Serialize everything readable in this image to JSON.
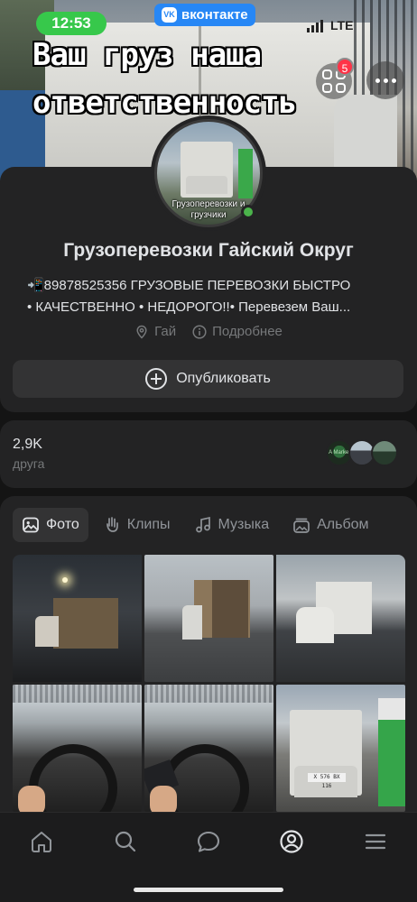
{
  "status_bar": {
    "time": "12:53",
    "network": "LTE"
  },
  "app_badge": {
    "label": "вконтакте"
  },
  "cover": {
    "title_line1": "Ваш груз наша",
    "title_line2": "ответственность"
  },
  "apps_button": {
    "badge_count": "5",
    "icon": "apps-grid-icon"
  },
  "more_button": {
    "icon": "more-horizontal-icon"
  },
  "profile": {
    "avatar_caption": "Грузоперевозки и грузчики",
    "online": true,
    "name": "Грузоперевозки Гайский Округ",
    "description_line1": "📲89878525356 ГРУЗОВЫЕ ПЕРЕВОЗКИ БЫСТРО",
    "description_line2": "• КАЧЕСТВЕННО • НЕДОРОГО!!• Перевезем Ваш...",
    "location": "Гай",
    "details": "Подробнее"
  },
  "publish_button": {
    "label": "Опубликовать"
  },
  "friends": {
    "count": "2,9K",
    "label": "друга",
    "avatar_tag": "A Market"
  },
  "media_tabs": [
    {
      "label": "Фото",
      "icon": "photo-icon",
      "active": true
    },
    {
      "label": "Клипы",
      "icon": "clips-icon",
      "active": false
    },
    {
      "label": "Музыка",
      "icon": "music-icon",
      "active": false
    },
    {
      "label": "Альбом",
      "icon": "album-icon",
      "active": false
    }
  ],
  "photos": [
    {
      "name": "photo-truck-night"
    },
    {
      "name": "photo-truck-open-doors"
    },
    {
      "name": "photo-white-gazelle"
    },
    {
      "name": "photo-steering-wheel"
    },
    {
      "name": "photo-driving-hands"
    },
    {
      "name": "photo-gazelle-gas-station",
      "plate": "X 576 BX 116"
    }
  ],
  "bottom_nav": [
    {
      "icon": "home-icon",
      "active": false
    },
    {
      "icon": "search-icon",
      "active": false
    },
    {
      "icon": "messages-icon",
      "active": false
    },
    {
      "icon": "profile-icon",
      "active": true
    },
    {
      "icon": "menu-icon",
      "active": false
    }
  ],
  "colors": {
    "background": "#141414",
    "card": "#232324",
    "accent_blue": "#2787f5",
    "online_green": "#4bb34b",
    "time_pill": "#37c84b",
    "badge_red": "#ff3347"
  }
}
